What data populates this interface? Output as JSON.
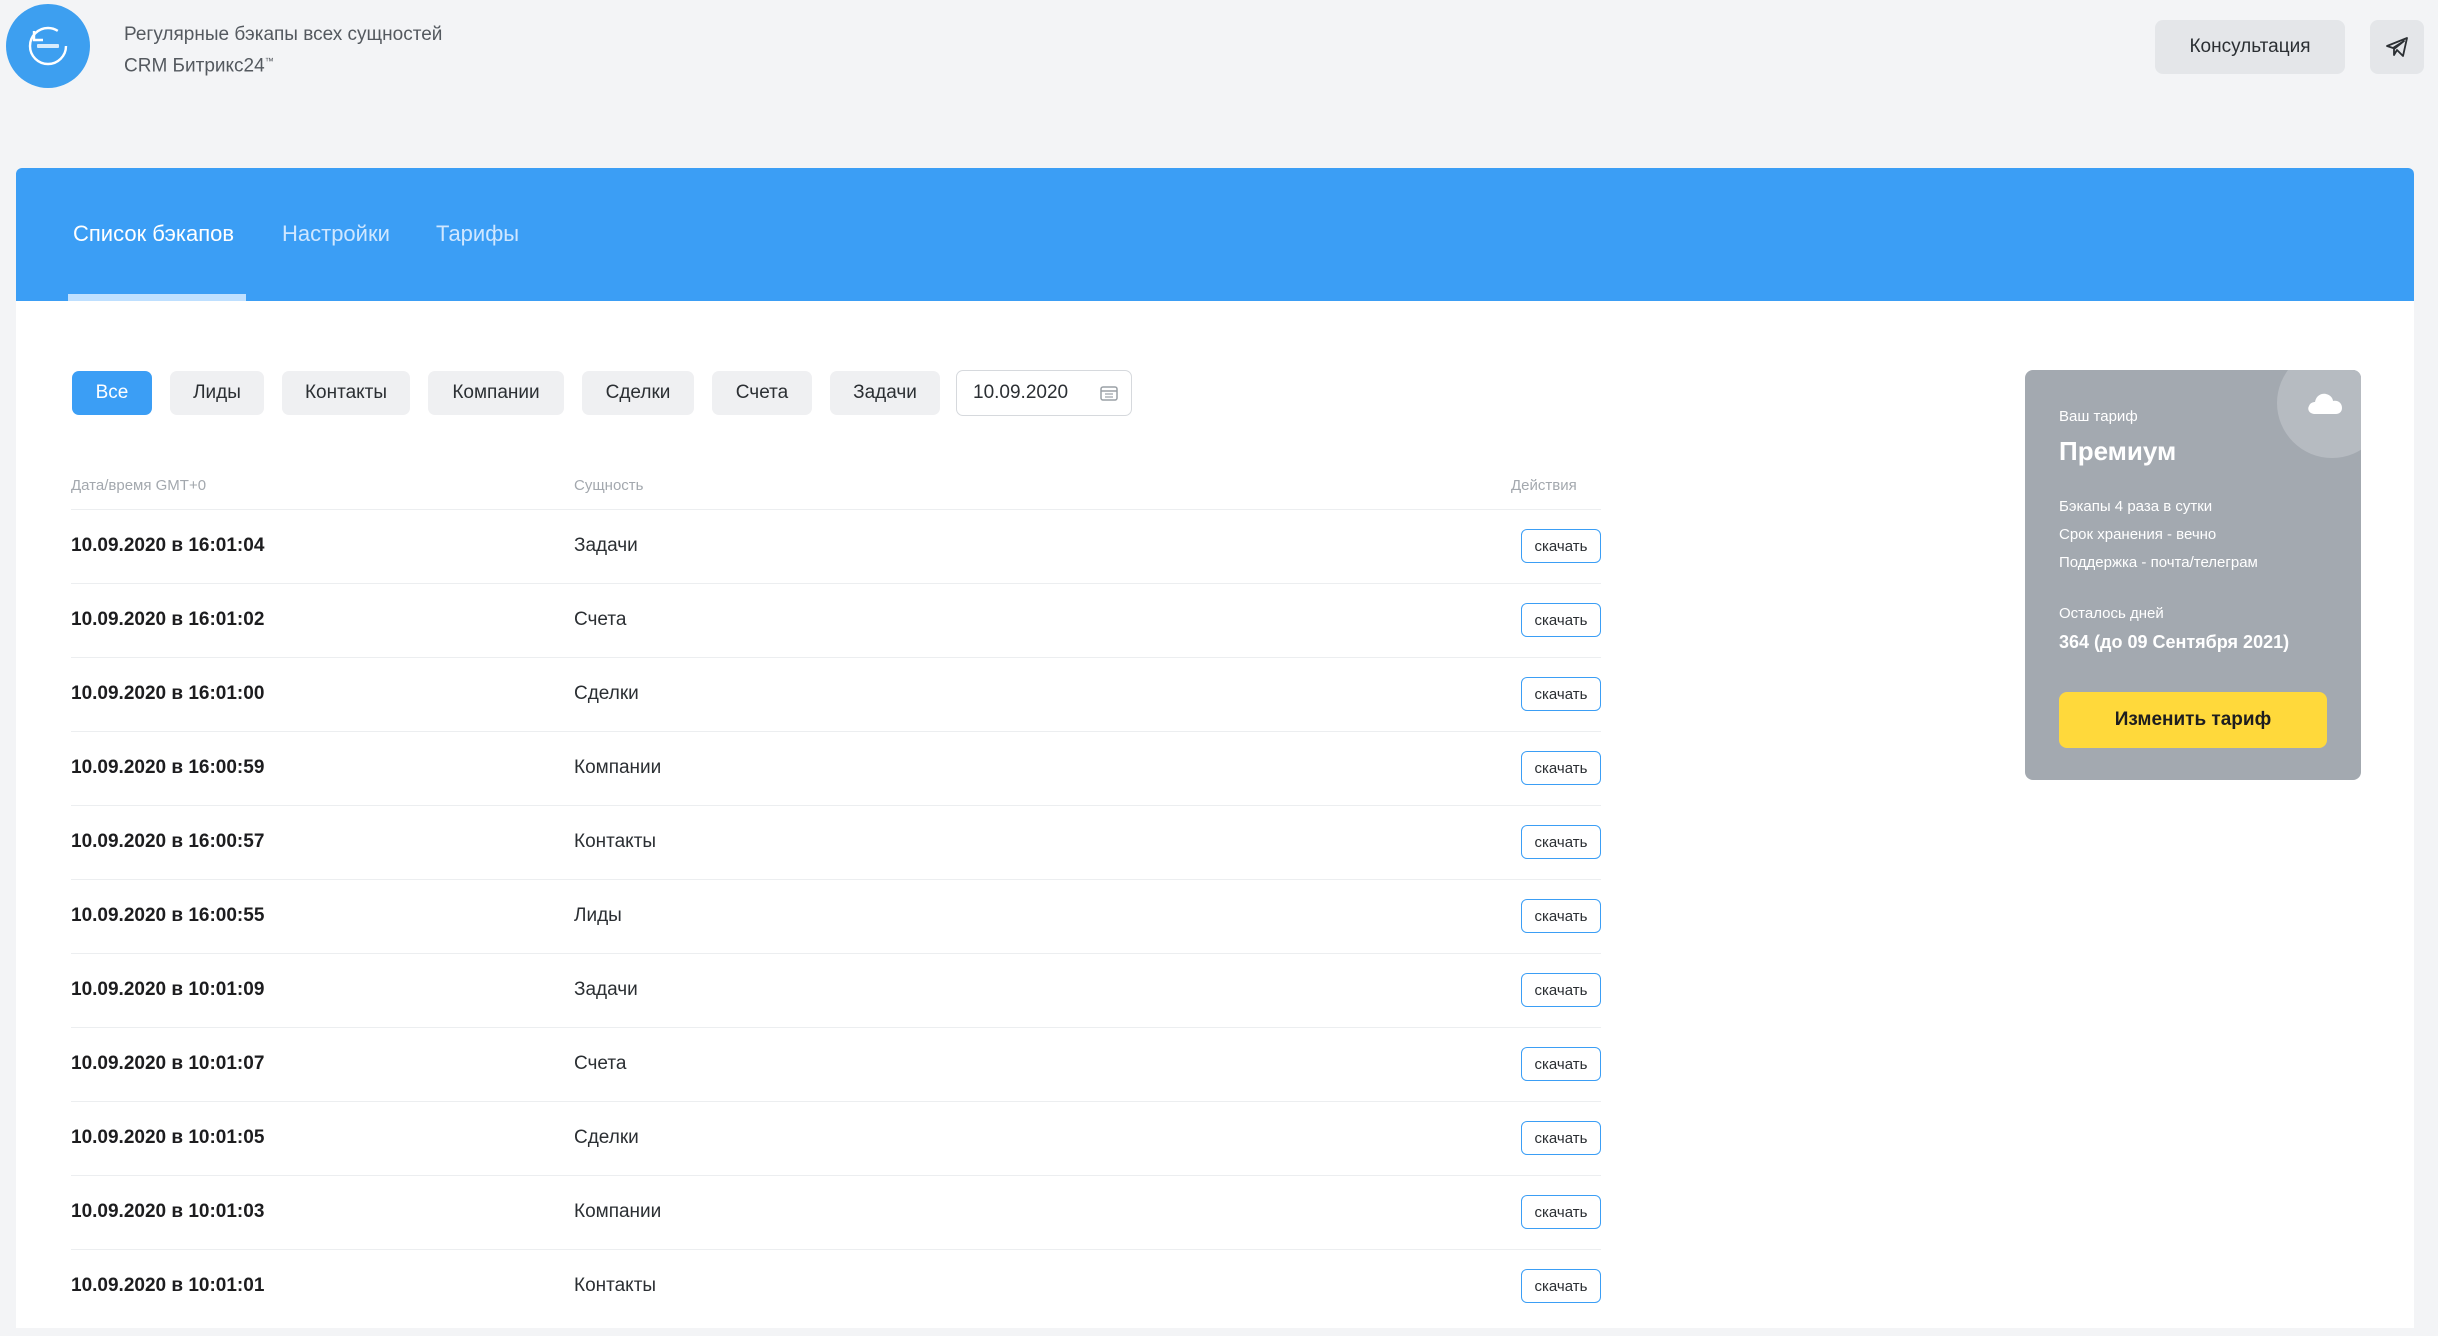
{
  "header": {
    "logo_icon": "backup-logo-icon",
    "line1": "Регулярные бэкапы всех сущностей",
    "line2": "CRM Битрикс24",
    "trademark": "™",
    "consult_button": "Консультация",
    "telegram_icon": "send-icon"
  },
  "tabs": [
    {
      "label": "Список бэкапов",
      "active": true
    },
    {
      "label": "Настройки",
      "active": false
    },
    {
      "label": "Тарифы",
      "active": false
    }
  ],
  "filters": {
    "chips": [
      "Все",
      "Лиды",
      "Контакты",
      "Компании",
      "Сделки",
      "Счета",
      "Задачи"
    ],
    "active": "Все",
    "date_value": "10.09.2020",
    "date_icon": "calendar-icon"
  },
  "table": {
    "headers": {
      "datetime": "Дата/время GMT+0",
      "entity": "Сущность",
      "actions": "Действия"
    },
    "download_label": "скачать",
    "rows": [
      {
        "datetime": "10.09.2020 в 16:01:04",
        "entity": "Задачи"
      },
      {
        "datetime": "10.09.2020 в 16:01:02",
        "entity": "Счета"
      },
      {
        "datetime": "10.09.2020 в 16:01:00",
        "entity": "Сделки"
      },
      {
        "datetime": "10.09.2020 в 16:00:59",
        "entity": "Компании"
      },
      {
        "datetime": "10.09.2020 в 16:00:57",
        "entity": "Контакты"
      },
      {
        "datetime": "10.09.2020 в 16:00:55",
        "entity": "Лиды"
      },
      {
        "datetime": "10.09.2020 в 10:01:09",
        "entity": "Задачи"
      },
      {
        "datetime": "10.09.2020 в 10:01:07",
        "entity": "Счета"
      },
      {
        "datetime": "10.09.2020 в 10:01:05",
        "entity": "Сделки"
      },
      {
        "datetime": "10.09.2020 в 10:01:03",
        "entity": "Компании"
      },
      {
        "datetime": "10.09.2020 в 10:01:01",
        "entity": "Контакты"
      }
    ]
  },
  "tariff": {
    "label": "Ваш тариф",
    "name": "Премиум",
    "features": [
      "Бэкапы 4 раза в сутки",
      "Срок хранения - вечно",
      "Поддержка - почта/телеграм"
    ],
    "days_label": "Осталось дней",
    "days_value": "364 (до 09 Сентября 2021)",
    "change_button": "Изменить тариф",
    "icon": "cloud-icon"
  },
  "colors": {
    "accent": "#3b9ef5",
    "tariff_bg": "#a3a9b0",
    "cta": "#ffd93b"
  }
}
